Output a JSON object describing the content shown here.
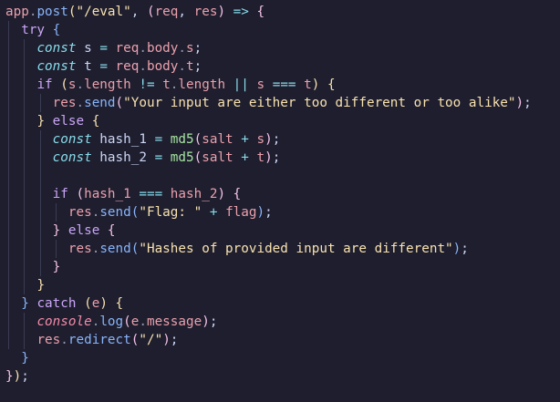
{
  "editor": {
    "lines": [
      [
        {
          "t": "app",
          "c": "t-obj"
        },
        {
          "t": ".",
          "c": "t-punct"
        },
        {
          "t": "post",
          "c": "t-method"
        },
        {
          "t": "(",
          "c": "t-brace-y"
        },
        {
          "t": "\"/eval\"",
          "c": "t-text"
        },
        {
          "t": ", ",
          "c": "t-plain"
        },
        {
          "t": "(",
          "c": "t-brace-p"
        },
        {
          "t": "req",
          "c": "t-param"
        },
        {
          "t": ", ",
          "c": "t-plain"
        },
        {
          "t": "res",
          "c": "t-param"
        },
        {
          "t": ")",
          "c": "t-brace-p"
        },
        {
          "t": " => ",
          "c": "t-decl"
        },
        {
          "t": "{",
          "c": "t-brace-p"
        }
      ],
      [
        {
          "t": "  ",
          "c": "t-plain"
        },
        {
          "t": "try",
          "c": "t-kw"
        },
        {
          "t": " ",
          "c": "t-plain"
        },
        {
          "t": "{",
          "c": "t-brace-b"
        }
      ],
      [
        {
          "t": "    ",
          "c": "t-plain"
        },
        {
          "t": "const",
          "c": "t-decl"
        },
        {
          "t": " s ",
          "c": "t-plain"
        },
        {
          "t": "=",
          "c": "t-op"
        },
        {
          "t": " req",
          "c": "t-obj"
        },
        {
          "t": ".",
          "c": "t-punct"
        },
        {
          "t": "body",
          "c": "t-obj"
        },
        {
          "t": ".",
          "c": "t-punct"
        },
        {
          "t": "s",
          "c": "t-obj"
        },
        {
          "t": ";",
          "c": "t-plain"
        }
      ],
      [
        {
          "t": "    ",
          "c": "t-plain"
        },
        {
          "t": "const",
          "c": "t-decl"
        },
        {
          "t": " t ",
          "c": "t-plain"
        },
        {
          "t": "=",
          "c": "t-op"
        },
        {
          "t": " req",
          "c": "t-obj"
        },
        {
          "t": ".",
          "c": "t-punct"
        },
        {
          "t": "body",
          "c": "t-obj"
        },
        {
          "t": ".",
          "c": "t-punct"
        },
        {
          "t": "t",
          "c": "t-obj"
        },
        {
          "t": ";",
          "c": "t-plain"
        }
      ],
      [
        {
          "t": "    ",
          "c": "t-plain"
        },
        {
          "t": "if",
          "c": "t-kw"
        },
        {
          "t": " ",
          "c": "t-plain"
        },
        {
          "t": "(",
          "c": "t-brace-y"
        },
        {
          "t": "s",
          "c": "t-obj"
        },
        {
          "t": ".",
          "c": "t-punct"
        },
        {
          "t": "length",
          "c": "t-obj"
        },
        {
          "t": " != ",
          "c": "t-op"
        },
        {
          "t": "t",
          "c": "t-obj"
        },
        {
          "t": ".",
          "c": "t-punct"
        },
        {
          "t": "length",
          "c": "t-obj"
        },
        {
          "t": " || ",
          "c": "t-op"
        },
        {
          "t": "s",
          "c": "t-obj"
        },
        {
          "t": " === ",
          "c": "t-op"
        },
        {
          "t": "t",
          "c": "t-obj"
        },
        {
          "t": ")",
          "c": "t-brace-y"
        },
        {
          "t": " ",
          "c": "t-plain"
        },
        {
          "t": "{",
          "c": "t-brace-y"
        }
      ],
      [
        {
          "t": "      ",
          "c": "t-plain"
        },
        {
          "t": "res",
          "c": "t-obj"
        },
        {
          "t": ".",
          "c": "t-punct"
        },
        {
          "t": "send",
          "c": "t-method"
        },
        {
          "t": "(",
          "c": "t-brace-p"
        },
        {
          "t": "\"Your input are either too different or too alike\"",
          "c": "t-text"
        },
        {
          "t": ")",
          "c": "t-brace-p"
        },
        {
          "t": ";",
          "c": "t-plain"
        }
      ],
      [
        {
          "t": "    ",
          "c": "t-plain"
        },
        {
          "t": "}",
          "c": "t-brace-y"
        },
        {
          "t": " ",
          "c": "t-plain"
        },
        {
          "t": "else",
          "c": "t-kw"
        },
        {
          "t": " ",
          "c": "t-plain"
        },
        {
          "t": "{",
          "c": "t-brace-y"
        }
      ],
      [
        {
          "t": "      ",
          "c": "t-plain"
        },
        {
          "t": "const",
          "c": "t-decl"
        },
        {
          "t": " hash_1 ",
          "c": "t-plain"
        },
        {
          "t": "=",
          "c": "t-op"
        },
        {
          "t": " ",
          "c": "t-plain"
        },
        {
          "t": "md5",
          "c": "t-func"
        },
        {
          "t": "(",
          "c": "t-brace-p"
        },
        {
          "t": "salt",
          "c": "t-obj"
        },
        {
          "t": " + ",
          "c": "t-op"
        },
        {
          "t": "s",
          "c": "t-obj"
        },
        {
          "t": ")",
          "c": "t-brace-p"
        },
        {
          "t": ";",
          "c": "t-plain"
        }
      ],
      [
        {
          "t": "      ",
          "c": "t-plain"
        },
        {
          "t": "const",
          "c": "t-decl"
        },
        {
          "t": " hash_2 ",
          "c": "t-plain"
        },
        {
          "t": "=",
          "c": "t-op"
        },
        {
          "t": " ",
          "c": "t-plain"
        },
        {
          "t": "md5",
          "c": "t-func"
        },
        {
          "t": "(",
          "c": "t-brace-p"
        },
        {
          "t": "salt",
          "c": "t-obj"
        },
        {
          "t": " + ",
          "c": "t-op"
        },
        {
          "t": "t",
          "c": "t-obj"
        },
        {
          "t": ")",
          "c": "t-brace-p"
        },
        {
          "t": ";",
          "c": "t-plain"
        }
      ],
      [],
      [
        {
          "t": "      ",
          "c": "t-plain"
        },
        {
          "t": "if",
          "c": "t-kw"
        },
        {
          "t": " ",
          "c": "t-plain"
        },
        {
          "t": "(",
          "c": "t-brace-p"
        },
        {
          "t": "hash_1",
          "c": "t-obj"
        },
        {
          "t": " === ",
          "c": "t-op"
        },
        {
          "t": "hash_2",
          "c": "t-obj"
        },
        {
          "t": ")",
          "c": "t-brace-p"
        },
        {
          "t": " ",
          "c": "t-plain"
        },
        {
          "t": "{",
          "c": "t-brace-p"
        }
      ],
      [
        {
          "t": "        ",
          "c": "t-plain"
        },
        {
          "t": "res",
          "c": "t-obj"
        },
        {
          "t": ".",
          "c": "t-punct"
        },
        {
          "t": "send",
          "c": "t-method"
        },
        {
          "t": "(",
          "c": "t-brace-b"
        },
        {
          "t": "\"Flag: \"",
          "c": "t-text"
        },
        {
          "t": " + ",
          "c": "t-op"
        },
        {
          "t": "flag",
          "c": "t-obj"
        },
        {
          "t": ")",
          "c": "t-brace-b"
        },
        {
          "t": ";",
          "c": "t-plain"
        }
      ],
      [
        {
          "t": "      ",
          "c": "t-plain"
        },
        {
          "t": "}",
          "c": "t-brace-p"
        },
        {
          "t": " ",
          "c": "t-plain"
        },
        {
          "t": "else",
          "c": "t-kw"
        },
        {
          "t": " ",
          "c": "t-plain"
        },
        {
          "t": "{",
          "c": "t-brace-p"
        }
      ],
      [
        {
          "t": "        ",
          "c": "t-plain"
        },
        {
          "t": "res",
          "c": "t-obj"
        },
        {
          "t": ".",
          "c": "t-punct"
        },
        {
          "t": "send",
          "c": "t-method"
        },
        {
          "t": "(",
          "c": "t-brace-b"
        },
        {
          "t": "\"Hashes of provided input are different\"",
          "c": "t-text"
        },
        {
          "t": ")",
          "c": "t-brace-b"
        },
        {
          "t": ";",
          "c": "t-plain"
        }
      ],
      [
        {
          "t": "      ",
          "c": "t-plain"
        },
        {
          "t": "}",
          "c": "t-brace-p"
        }
      ],
      [
        {
          "t": "    ",
          "c": "t-plain"
        },
        {
          "t": "}",
          "c": "t-brace-y"
        }
      ],
      [
        {
          "t": "  ",
          "c": "t-plain"
        },
        {
          "t": "}",
          "c": "t-brace-b"
        },
        {
          "t": " ",
          "c": "t-plain"
        },
        {
          "t": "catch",
          "c": "t-kw"
        },
        {
          "t": " ",
          "c": "t-plain"
        },
        {
          "t": "(",
          "c": "t-brace-y"
        },
        {
          "t": "e",
          "c": "t-param"
        },
        {
          "t": ")",
          "c": "t-brace-y"
        },
        {
          "t": " ",
          "c": "t-plain"
        },
        {
          "t": "{",
          "c": "t-brace-y"
        }
      ],
      [
        {
          "t": "    ",
          "c": "t-plain"
        },
        {
          "t": "console",
          "c": "t-cons"
        },
        {
          "t": ".",
          "c": "t-punct"
        },
        {
          "t": "log",
          "c": "t-method"
        },
        {
          "t": "(",
          "c": "t-brace-p"
        },
        {
          "t": "e",
          "c": "t-obj"
        },
        {
          "t": ".",
          "c": "t-punct"
        },
        {
          "t": "message",
          "c": "t-obj"
        },
        {
          "t": ")",
          "c": "t-brace-p"
        },
        {
          "t": ";",
          "c": "t-plain"
        }
      ],
      [
        {
          "t": "    ",
          "c": "t-plain"
        },
        {
          "t": "res",
          "c": "t-obj"
        },
        {
          "t": ".",
          "c": "t-punct"
        },
        {
          "t": "redirect",
          "c": "t-method"
        },
        {
          "t": "(",
          "c": "t-brace-p"
        },
        {
          "t": "\"/\"",
          "c": "t-text"
        },
        {
          "t": ")",
          "c": "t-brace-p"
        },
        {
          "t": ";",
          "c": "t-plain"
        }
      ],
      [
        {
          "t": "  ",
          "c": "t-plain"
        },
        {
          "t": "}",
          "c": "t-brace-b"
        }
      ],
      [
        {
          "t": "}",
          "c": "t-brace-p"
        },
        {
          "t": ")",
          "c": "t-brace-y"
        },
        {
          "t": ";",
          "c": "t-plain"
        }
      ]
    ]
  }
}
